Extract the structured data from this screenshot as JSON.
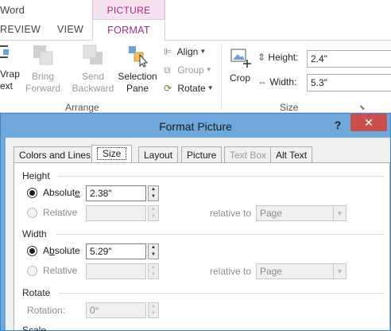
{
  "ribbon": {
    "app_name": "Word",
    "context_label": "PICTURE TOOLS",
    "tabs": [
      {
        "label": "REVIEW"
      },
      {
        "label": "VIEW"
      },
      {
        "label": "FORMAT",
        "active": true
      }
    ],
    "arrange": {
      "wrap_line1": "Vrap",
      "wrap_line2": "ext",
      "bring_forward_line1": "Bring",
      "bring_forward_line2": "Forward",
      "send_backward_line1": "Send",
      "send_backward_line2": "Backward",
      "selection_pane_line1": "Selection",
      "selection_pane_line2": "Pane",
      "align": "Align",
      "group": "Group",
      "rotate": "Rotate",
      "group_label": "Arrange"
    },
    "size": {
      "crop": "Crop",
      "height_label": "Height:",
      "height_value": "2.4\"",
      "width_label": "Width:",
      "width_value": "5.3\"",
      "group_label": "Size"
    }
  },
  "dialog": {
    "title": "Format Picture",
    "help": "?",
    "close": "✕",
    "tabs": [
      {
        "label": "Colors and Lines"
      },
      {
        "label": "Size",
        "selected": true
      },
      {
        "label": "Layout"
      },
      {
        "label": "Picture"
      },
      {
        "label": "Text Box",
        "disabled": true
      },
      {
        "label": "Alt Text"
      }
    ],
    "height": {
      "section": "Height",
      "absolute_pre": "Absolut",
      "absolute_u": "e",
      "absolute_value": "2.38\"",
      "relative": "Relative",
      "relative_to": "relative to",
      "relative_to_value": "Page"
    },
    "width": {
      "section": "Width",
      "absolute_pre": "A",
      "absolute_u": "b",
      "absolute_post": "solute",
      "absolute_value": "5.29\"",
      "relative": "Relative",
      "relative_to": "relative to",
      "relative_to_value": "Page"
    },
    "rotate": {
      "section": "Rotate",
      "rotation_label": "Rotation:",
      "rotation_value": "0°"
    },
    "scale": {
      "section": "Scale"
    }
  },
  "colors": {
    "accent": "#a02b7c",
    "dialog_frame": "#6fa9dc",
    "close_button": "#c7504f"
  }
}
